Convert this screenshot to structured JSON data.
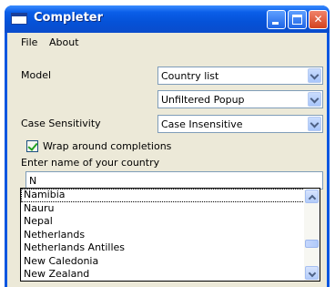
{
  "window": {
    "title": "Completer"
  },
  "menu": {
    "items": [
      "File",
      "About"
    ]
  },
  "form": {
    "model_label": "Model",
    "model_value": "Country list",
    "completion_mode_value": "Unfiltered Popup",
    "case_label": "Case Sensitivity",
    "case_value": "Case Insensitive",
    "wrap_label": "Wrap around completions",
    "wrap_checked": true,
    "country_label": "Enter name of your country",
    "country_value": "N"
  },
  "popup": {
    "items": [
      "Namibia",
      "Nauru",
      "Nepal",
      "Netherlands",
      "Netherlands Antilles",
      "New Caledonia",
      "New Zealand"
    ],
    "current_index": 0
  }
}
